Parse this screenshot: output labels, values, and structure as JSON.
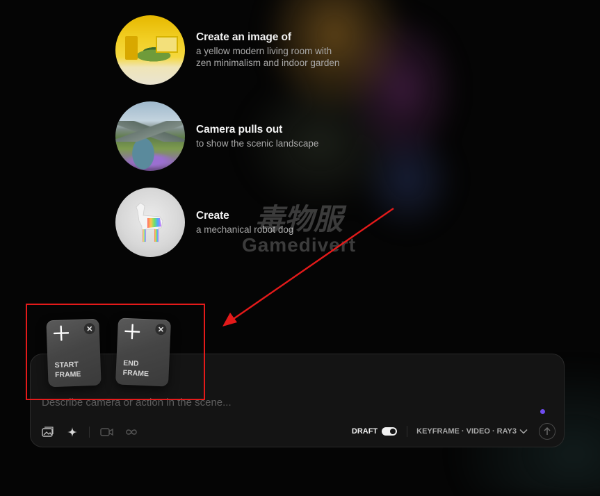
{
  "suggestions": [
    {
      "title": "Create an image of",
      "subtitle_line1": "a yellow modern living room with",
      "subtitle_line2": "zen minimalism and indoor garden",
      "image": "yellow-living-room"
    },
    {
      "title": "Camera pulls out",
      "subtitle_line1": "to show the scenic landscape",
      "image": "mountain-landscape"
    },
    {
      "title": "Create",
      "subtitle_line1": "a mechanical robot dog",
      "image": "robot-dog"
    }
  ],
  "watermark": {
    "cjk": "毒物服",
    "latin": "Gamedivert"
  },
  "frames": {
    "start": {
      "label": "START\nFRAME"
    },
    "end": {
      "label": "END\nFRAME"
    }
  },
  "composer": {
    "placeholder": "Describe camera or action in the scene...",
    "draft_label": "DRAFT",
    "draft_enabled": true,
    "model_label": "KEYFRAME · VIDEO · RAY3"
  },
  "colors": {
    "background": "#050505",
    "composer_bg": "#141414",
    "accent_dot": "#6f4cf0",
    "annotation_red": "#e41a1a"
  }
}
